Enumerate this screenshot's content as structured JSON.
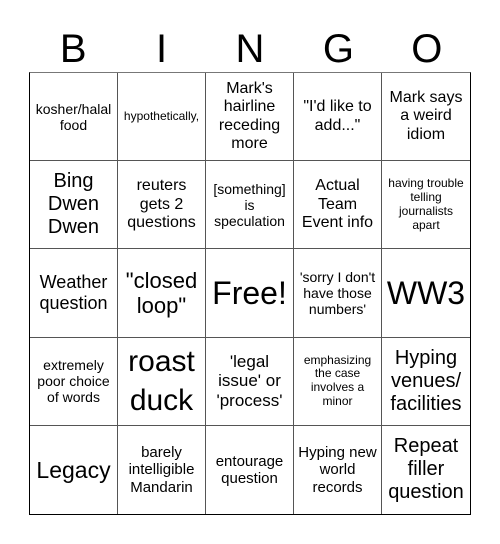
{
  "header": {
    "letters": [
      "B",
      "I",
      "N",
      "G",
      "O"
    ]
  },
  "board": {
    "cells": [
      "kosher/halal food",
      "hypothetically,",
      "Mark's hairline receding more",
      "\"I'd like to add...\"",
      "Mark says a weird idiom",
      "Bing Dwen Dwen",
      "reuters gets 2 questions",
      "[something] is speculation",
      "Actual Team Event info",
      "having trouble telling journalists apart",
      "Weather question",
      "\"closed loop\"",
      "Free!",
      "'sorry I don't have those numbers'",
      "WW3",
      "extremely poor choice of words",
      "roast duck",
      "'legal issue' or 'process'",
      "emphasizing the case involves a minor",
      "Hyping venues/ facilities",
      "Legacy",
      "barely intelligible Mandarin",
      "entourage question",
      "Hyping new world records",
      "Repeat filler question"
    ]
  }
}
